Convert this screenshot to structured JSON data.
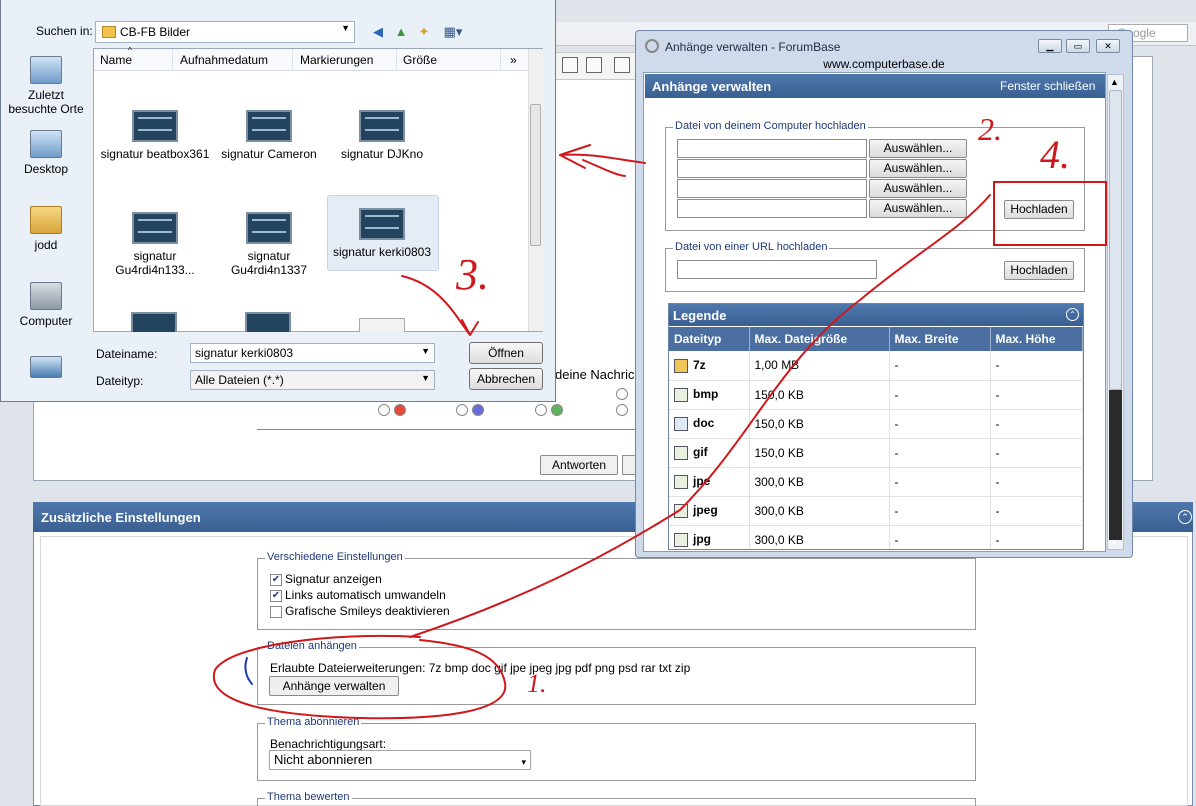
{
  "background": {
    "search_placeholder": "Google",
    "message_fragment": "deine Nachric",
    "reply_button": "Antworten",
    "extra_settings": {
      "title": "Zusätzliche Einstellungen",
      "misc_legend": "Verschiedene Einstellungen",
      "options": [
        {
          "label": "Signatur anzeigen",
          "checked": true
        },
        {
          "label": "Links automatisch umwandeln",
          "checked": true
        },
        {
          "label": "Grafische Smileys deaktivieren",
          "checked": false
        }
      ],
      "attach_legend": "Dateien anhängen",
      "allowed_ext_text": "Erlaubte Dateierweiterungen: 7z bmp doc gif jpe jpeg jpg pdf png psd rar txt zip",
      "manage_button": "Anhänge verwalten",
      "subscribe_legend": "Thema abonnieren",
      "notify_label": "Benachrichtigungsart:",
      "notify_value": "Nicht abonnieren",
      "rate_legend": "Thema bewerten"
    }
  },
  "file_dialog": {
    "look_in_label": "Suchen in:",
    "look_in_value": "CB-FB Bilder",
    "columns": [
      "Name",
      "Aufnahmedatum",
      "Markierungen",
      "Größe"
    ],
    "more_columns": "»",
    "places": [
      "Zuletzt besuchte Orte",
      "Desktop",
      "jodd",
      "Computer"
    ],
    "files": [
      "signatur beatbox361",
      "signatur Cameron",
      "signatur DJKno",
      "signatur Gu4rdi4n133...",
      "signatur Gu4rdi4n1337",
      "signatur kerki0803"
    ],
    "filename_label": "Dateiname:",
    "filename_value": "signatur kerki0803",
    "filetype_label": "Dateityp:",
    "filetype_value": "Alle Dateien (*.*)",
    "open_button": "Öffnen",
    "cancel_button": "Abbrechen"
  },
  "attach_window": {
    "title": "Anhänge verwalten - ForumBase",
    "url": "www.computerbase.de",
    "header": "Anhänge verwalten",
    "close_link": "Fenster schließen",
    "upload_local_legend": "Datei von deinem Computer hochladen",
    "choose_buttons": [
      "Auswählen...",
      "Auswählen...",
      "Auswählen...",
      "Auswählen..."
    ],
    "upload_button": "Hochladen",
    "upload_url_legend": "Datei von einer URL hochladen",
    "upload_url_button": "Hochladen",
    "legend_title": "Legende",
    "table_headers": [
      "Dateityp",
      "Max. Dateigröße",
      "Max. Breite",
      "Max. Höhe"
    ],
    "rows": [
      {
        "type": "7z",
        "size": "1,00 MB",
        "width": "-",
        "height": "-"
      },
      {
        "type": "bmp",
        "size": "150,0 KB",
        "width": "-",
        "height": "-"
      },
      {
        "type": "doc",
        "size": "150,0 KB",
        "width": "-",
        "height": "-"
      },
      {
        "type": "gif",
        "size": "150,0 KB",
        "width": "-",
        "height": "-"
      },
      {
        "type": "jpe",
        "size": "300,0 KB",
        "width": "-",
        "height": "-"
      },
      {
        "type": "jpeg",
        "size": "300,0 KB",
        "width": "-",
        "height": "-"
      },
      {
        "type": "jpg",
        "size": "300,0 KB",
        "width": "-",
        "height": "-"
      }
    ]
  },
  "annotations": {
    "step1": "1.",
    "step2": "2.",
    "step3": "3.",
    "step4": "4."
  }
}
